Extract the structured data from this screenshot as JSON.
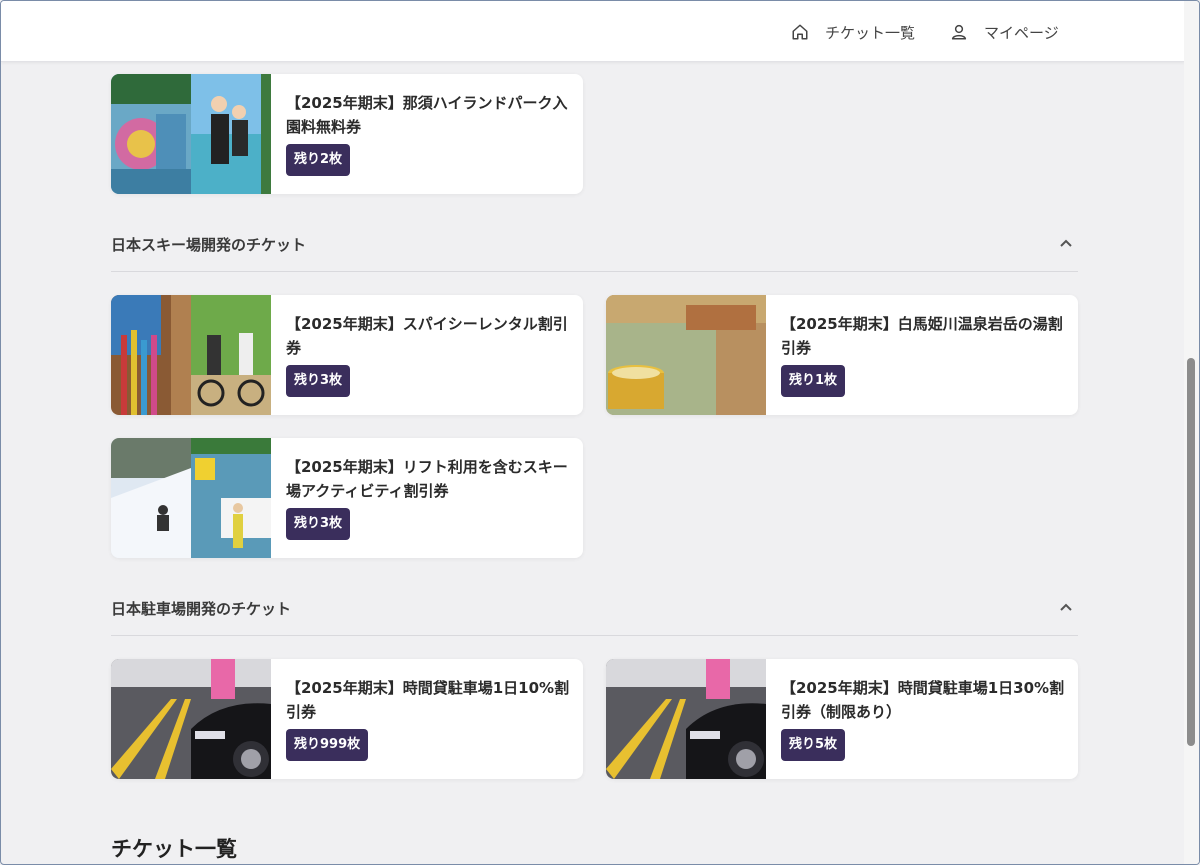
{
  "nav": {
    "tickets_label": "チケット一覧",
    "mypage_label": "マイページ"
  },
  "cards_top": [
    {
      "title": "【2025年期末】那須ハイランドパーク入園料無料券",
      "badge": "残り2枚"
    }
  ],
  "sections": [
    {
      "title": "日本スキー場開発のチケット",
      "cards": [
        {
          "title": "【2025年期末】スパイシーレンタル割引券",
          "badge": "残り3枚"
        },
        {
          "title": "【2025年期末】白馬姫川温泉岩岳の湯割引券",
          "badge": "残り1枚"
        },
        {
          "title": "【2025年期末】リフト利用を含むスキー場アクティビティ割引券",
          "badge": "残り3枚"
        }
      ]
    },
    {
      "title": "日本駐車場開発のチケット",
      "cards": [
        {
          "title": "【2025年期末】時間貸駐車場1日10%割引券",
          "badge": "残り999枚"
        },
        {
          "title": "【2025年期末】時間貸駐車場1日30%割引券（制限あり）",
          "badge": "残り5枚"
        }
      ]
    }
  ],
  "list_heading": "チケット一覧",
  "colors": {
    "badge": "#3a2e5c",
    "background": "#f0f0f2"
  }
}
